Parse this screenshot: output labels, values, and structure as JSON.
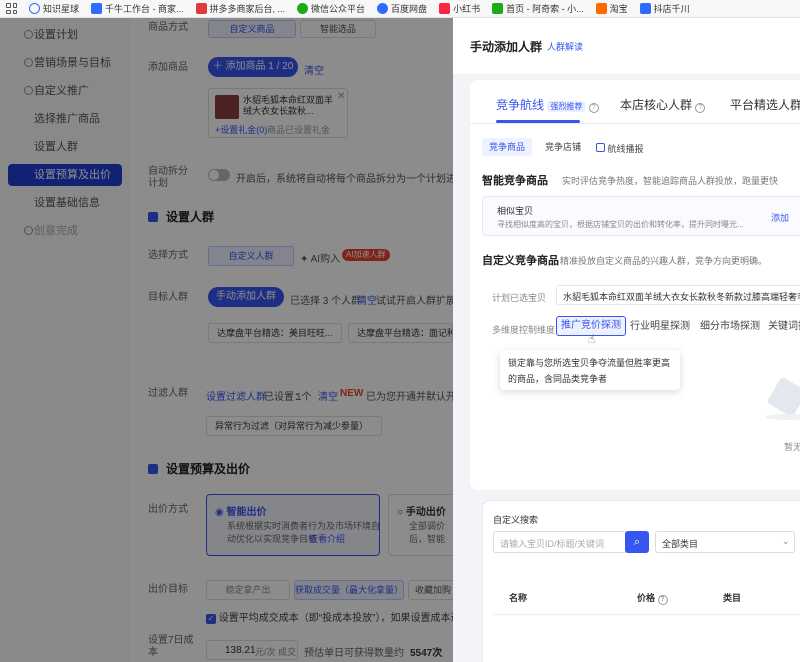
{
  "bookmarks": [
    {
      "label": "知识星球",
      "color": "#ffffff"
    },
    {
      "label": "千牛工作台 - 商家...",
      "color": "#2f6bff"
    },
    {
      "label": "拼多多商家后台, ...",
      "color": "#e0393e"
    },
    {
      "label": "微信公众平台",
      "color": "#1aad19"
    },
    {
      "label": "百度网盘",
      "color": "#2f6bff"
    },
    {
      "label": "小红书",
      "color": "#ff2442"
    },
    {
      "label": "首页 - 阿奇索 - 小...",
      "color": "#1aad19"
    },
    {
      "label": "淘宝",
      "color": "#ff6a00"
    },
    {
      "label": "抖店千川",
      "color": "#2f6bff"
    }
  ],
  "sidebar": {
    "items": [
      "设置计划",
      "营销场景与目标",
      "自定义推广",
      "选择推广商品",
      "设置人群",
      "设置预算及出价",
      "设置基础信息",
      "创意完成"
    ],
    "active": "设置预算及出价"
  },
  "form": {
    "product_method_label": "商品方式",
    "product_method_options": [
      "自定义商品",
      "智能选品"
    ],
    "add_product_label": "添加商品",
    "add_product_btn": "＋ 添加商品 1 / 20",
    "clear": "清空",
    "product_title": "水貂毛狐本命红双面羊绒大衣女长款秋...",
    "product_gift": "+设置礼金(0)",
    "product_hint": "商品已设置礼金",
    "auto_split_label": "自动拆分计划",
    "auto_split_desc": "开启后，系统将自动将每个商品拆分为一个计划进行投放",
    "set_crowd_title": "设置人群",
    "choose_method_label": "选择方式",
    "custom_crowd": "自定义人群",
    "ai_crowd": "AI购入",
    "ai_badge": "AI加速人群",
    "target_crowd_label": "目标人群",
    "add_crowd_btn": "手动添加人群",
    "selected_crowds": "已选择 3 个人群",
    "clear2": "清空",
    "trial_hint": "试试开启人群扩展",
    "crowd_chip_1": "达摩盘平台精选：美目旺旺...",
    "crowd_chip_2": "达摩盘平台精选：面记种...",
    "filter_label": "过滤人群",
    "filter_link": "设置过滤人群",
    "filter_set": "已设置：",
    "filter_count": "1个",
    "clear3": "清空",
    "new_badge": "NEW",
    "filter_new": "已为您开通并默认开启",
    "filter_chip": "异常行为过滤（对异常行为减少参量）",
    "budget_title": "设置预算及出价",
    "bid_method_label": "出价方式",
    "smart_bid": "智能出价",
    "smart_bid_desc_1": "系统根据实时消费者行为及市场环境自",
    "smart_bid_desc_2": "动优化以实现竞争目标",
    "smart_bid_link": "查看介绍",
    "manual_bid": "手动出价",
    "manual_bid_desc_1": "全部调价",
    "manual_bid_desc_2": "后，智能",
    "bid_goal_label": "出价目标",
    "goals": [
      "稳定拿产出",
      "获取成交量（最大化拿量）",
      "收藏加购"
    ],
    "avg_cost_check": "设置平均成交成本（即“投成本投放”），如果设置成本过低",
    "daily_budget_label": "设置7日成本",
    "daily_budget_value": "138.21",
    "daily_budget_unit": "元/次 成交",
    "daily_budget_hint": "预估单日可获得数量约",
    "daily_budget_count": "5547次"
  },
  "drawer": {
    "title": "手动添加人群",
    "title_link": "人群解读",
    "tabs": [
      {
        "label": "竞争航线",
        "badge": "强烈推荐",
        "active": true
      },
      {
        "label": "本店核心人群",
        "active": false
      },
      {
        "label": "平台精选人群",
        "active": false
      }
    ],
    "subtabs": [
      "竞争商品",
      "竞争店铺",
      "航线播报"
    ],
    "smart_title": "智能竞争商品",
    "smart_desc": "实时评估竞争热度，智能追踪商品人群投放，跑量更快",
    "similar_title": "相似宝贝",
    "similar_desc": "寻找相似度高的宝贝，根据店铺宝贝的出价和转化率，提升同时曝光...",
    "add": "添加",
    "custom_title": "自定义竞争商品",
    "custom_desc": "精准投放自定义商品的兴趣人群，竞争方向更明确。",
    "plan_selected_label": "计划已选宝贝",
    "plan_selected_value": "水貂毛狐本命红双面羊绒大衣女长款秋冬新款过膝高端轻奢毛呢",
    "dimension_label": "多维度控制维度",
    "dim_tabs": [
      "推广竞价探测",
      "行业明星探测",
      "细分市场探测",
      "关键词探测"
    ],
    "tooltip_line1": "锁定靠与您所选宝贝争夺流量但胜率更高",
    "tooltip_line2": "的商品，含同品类竞争者",
    "empty_text": "暂无",
    "search_title": "自定义搜索",
    "search_placeholder": "请输入宝贝ID/标题/关键词",
    "category_select": "全部类目",
    "table_headers": [
      "名称",
      "价格",
      "类目"
    ]
  },
  "colors": {
    "primary": "#3755f0",
    "overlay": "rgba(0,0,0,0.45)",
    "accent_red": "#e8432d"
  }
}
